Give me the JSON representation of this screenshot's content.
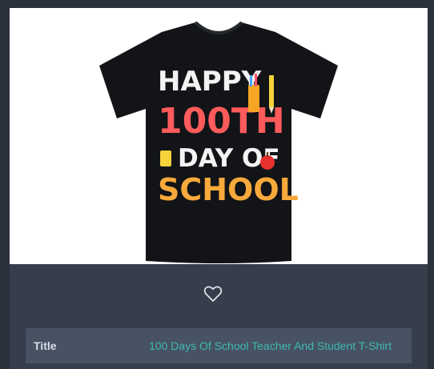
{
  "product": {
    "image": {
      "alt": "Black t-shirt with colorful Happy 100th Day Of School print",
      "print": {
        "line1": "HAPPY",
        "line2": "100TH",
        "line3": "DAY OF",
        "line4": "SCHOOL"
      },
      "shirt_color": "#121417"
    },
    "like_icon": "heart-outline-icon",
    "details": [
      {
        "label": "Title",
        "value": "100 Days Of School Teacher And Student T-Shirt"
      }
    ]
  },
  "colors": {
    "page_background": "#2b313b",
    "card_background": "#363e4b",
    "row_background": "#475263",
    "link": "#3fb9b0"
  }
}
